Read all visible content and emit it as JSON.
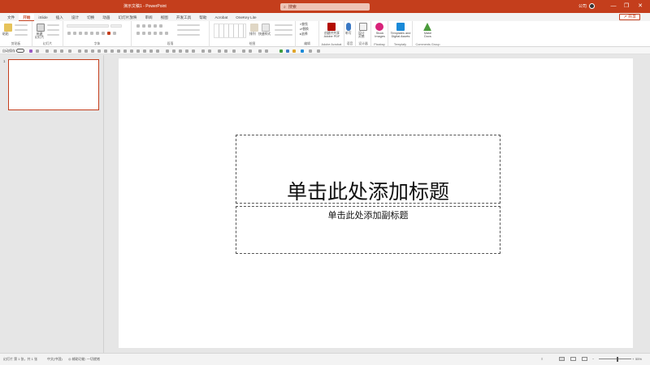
{
  "window": {
    "doc_title": "演示文稿1 - PowerPoint",
    "search_label": "搜索",
    "user_name": "公司",
    "minimize": "—",
    "restore": "❐",
    "close": "✕"
  },
  "tabs": [
    "文件",
    "开始",
    "iSlide",
    "插入",
    "设计",
    "切换",
    "动画",
    "幻灯片放映",
    "审阅",
    "视图",
    "开发工具",
    "帮助",
    "Acrobat",
    "OneKey Lite"
  ],
  "share_label": "共享",
  "ribbon": {
    "clipboard": {
      "paste": "粘贴",
      "label": "剪贴板"
    },
    "slides": {
      "new_slide": "新建\n幻灯片",
      "label": "幻灯片"
    },
    "font": {
      "label": "字体"
    },
    "paragraph": {
      "label": "段落"
    },
    "drawing": {
      "arrange": "排列",
      "quick_styles": "快速样式",
      "label": "绘图"
    },
    "editing": {
      "find": "查找",
      "replace": "替换",
      "select": "选择",
      "label": "编辑"
    },
    "acrobat": {
      "create_pdf": "创建并共享\nAdobe PDF",
      "label": "Adobe Acrobat"
    },
    "voice": {
      "dictate": "听写",
      "label": "语音"
    },
    "designer": {
      "design_ideas": "设计\n灵感",
      "label": "设计器"
    },
    "pixabay": {
      "stock": "Stock\nImages",
      "label": "Pixabay"
    },
    "templafy": {
      "templates": "Templates and\nDigital Assets",
      "label": "Templafy"
    },
    "comments": {
      "make_docs": "Make\nDocs",
      "label": "Comments Group"
    }
  },
  "qat": {
    "label": "自动保存"
  },
  "thumbnail": {
    "number": "1"
  },
  "slide": {
    "title_placeholder": "单击此处添加标题",
    "subtitle_placeholder": "单击此处添加副标题"
  },
  "status": {
    "slide_info": "幻灯片 第 1 张，共 1 张",
    "language": "中文(中国)",
    "accessibility": "辅助功能: 一切就绪",
    "zoom": "55%"
  },
  "colors": {
    "accent": "#c43e1c",
    "ribbon_bg": "#ffffff",
    "workspace": "#e6e6e6"
  }
}
